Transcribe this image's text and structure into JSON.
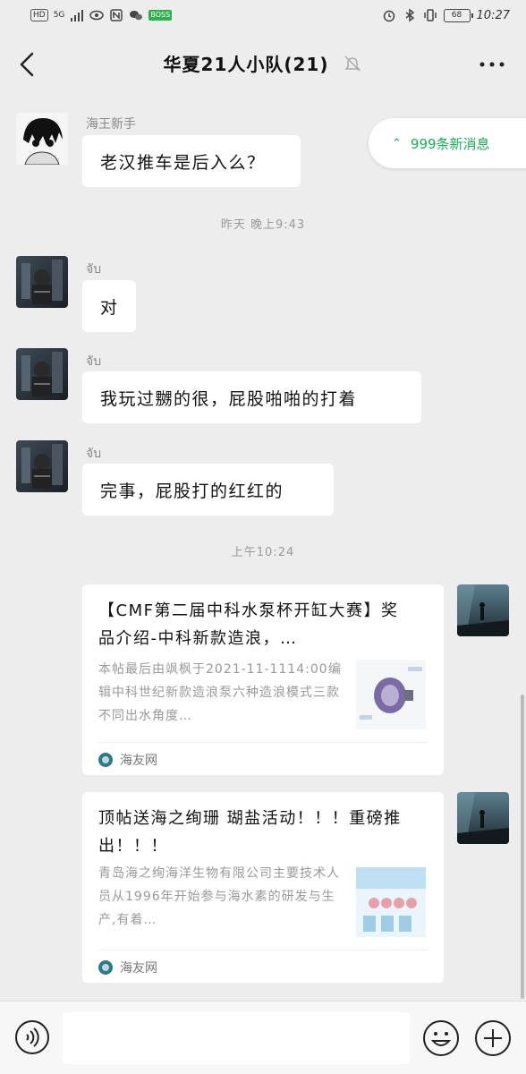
{
  "status_bar": {
    "hd": "HD",
    "network": "5G",
    "app_badge": "BOSS\n直聘",
    "battery": "68",
    "time": "10:27"
  },
  "header": {
    "title": "华夏21人小队(21)"
  },
  "new_messages": {
    "label": "999条新消息"
  },
  "messages": [
    {
      "sender": "海王新手",
      "text": "老汉推车是后入么？"
    },
    {
      "sender": "จับ",
      "text": "对"
    },
    {
      "sender": "จับ",
      "text": "我玩过嬲的很，屁股啪啪的打着"
    },
    {
      "sender": "จับ",
      "text": "完事，屁股打的红红的"
    }
  ],
  "timestamps": [
    "昨天 晚上9:43",
    "上午10:24"
  ],
  "cards": [
    {
      "title": "【CMF第二届中科水泵杯开缸大赛】奖品介绍-中科新款造浪，…",
      "desc": "本帖最后由飒枫于2021-11-1114:00编辑中科世纪新款造浪泵六种造浪模式三款不同出水角度…",
      "source": "海友网"
    },
    {
      "title": "顶帖送海之绚珊 瑚盐活动！！！重磅推出！！！",
      "desc": "青岛海之绚海洋生物有限公司主要技术人员从1996年开始参与海水素的研发与生产,有着…",
      "source": "海友网"
    }
  ],
  "input": {
    "placeholder": ""
  },
  "colors": {
    "background": "#ededed",
    "accent_green": "#1aad5a",
    "bubble": "#ffffff"
  }
}
